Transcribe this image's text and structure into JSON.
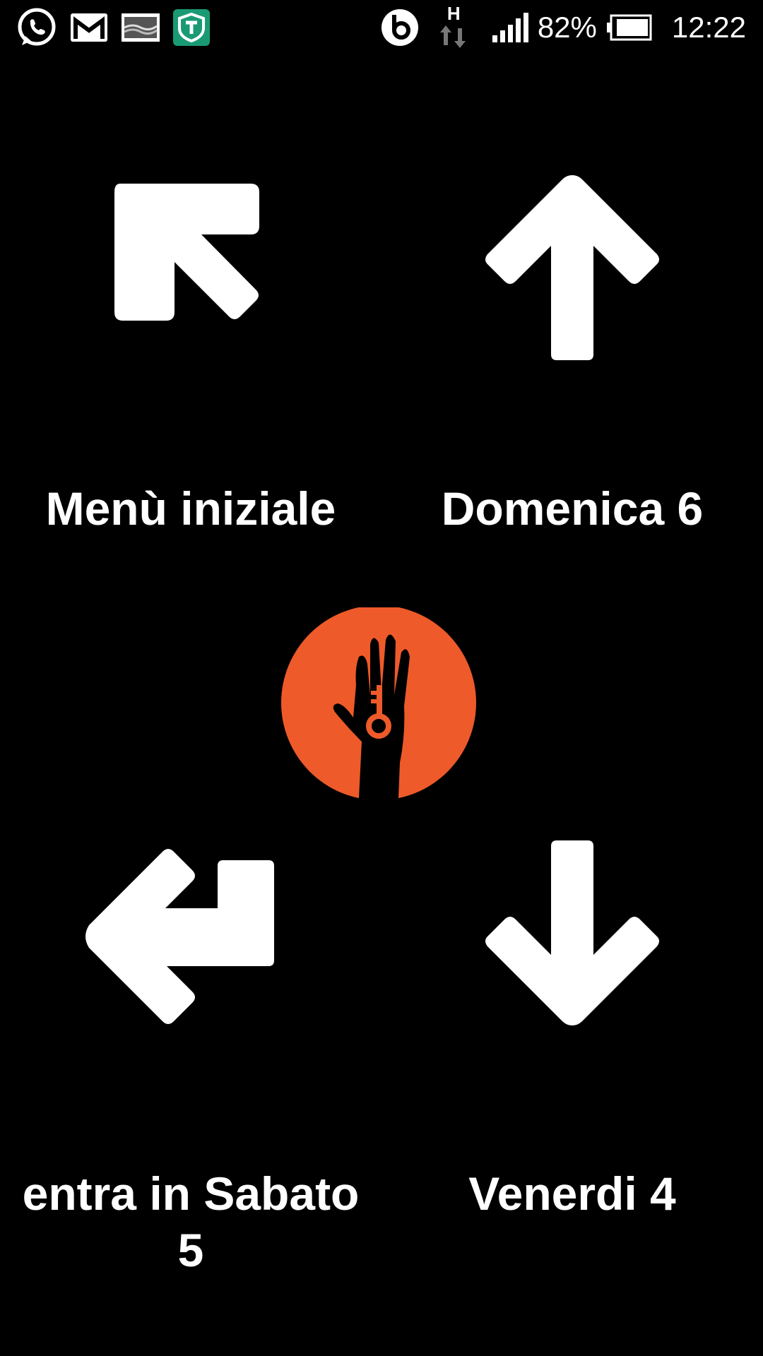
{
  "status_bar": {
    "left_icons": [
      "whatsapp-icon",
      "gmail-icon",
      "gallery-icon",
      "app-shield-icon"
    ],
    "right_icons": [
      "beats-icon",
      "hspa-data-icon",
      "signal-icon",
      "battery-icon"
    ],
    "network_type": "H",
    "battery_percent": "82%",
    "time": "12:22"
  },
  "navigation": {
    "home": {
      "label": "Menù iniziale",
      "icon": "arrow-up-left-icon"
    },
    "next": {
      "label": "Domenica 6",
      "icon": "arrow-up-icon"
    },
    "enter": {
      "label_line1": "entra in Sabato",
      "label_line2": "5",
      "icon": "arrow-enter-icon"
    },
    "previous": {
      "label": "Venerdi 4",
      "icon": "arrow-down-icon"
    }
  },
  "logo": {
    "icon": "hand-key-logo-icon",
    "color": "#ee5a2a"
  }
}
